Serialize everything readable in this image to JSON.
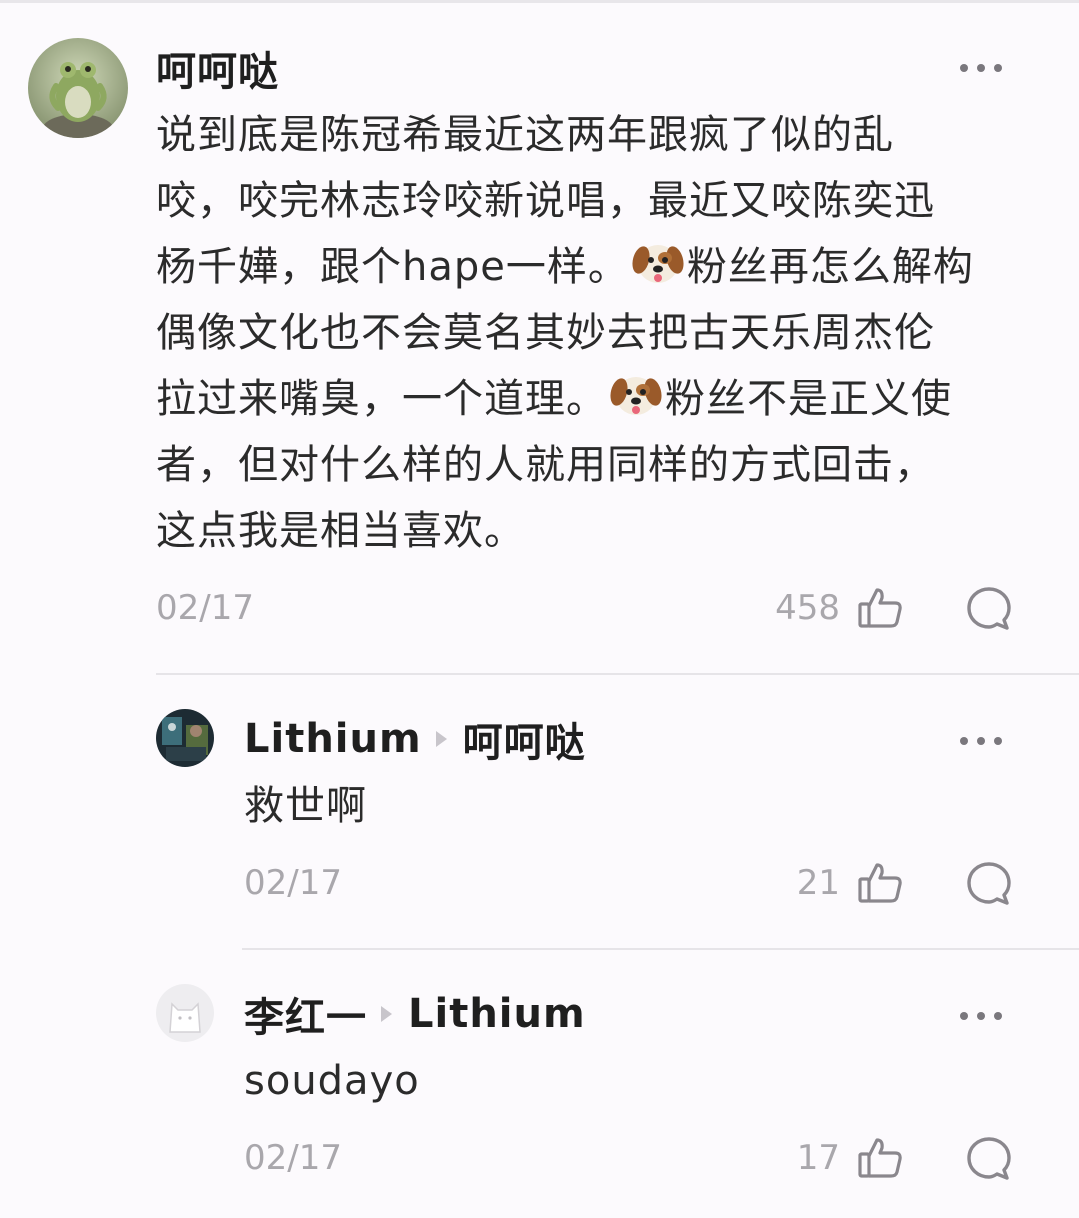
{
  "comments": [
    {
      "author": "呵呵哒",
      "avatar_icon": "frog-avatar-icon",
      "lines": [
        "说到底是陈冠希最近这两年跟疯了似的乱",
        "咬，咬完林志玲咬新说唱，最近又咬陈奕迅",
        "杨千嬅，跟个hape一样。",
        "粉丝再怎么解构",
        "偶像文化也不会莫名其妙去把古天乐周杰伦",
        "拉过来嘴臭，一个道理。",
        "粉丝不是正义使",
        "者，但对什么样的人就用同样的方式回击，",
        "这点我是相当喜欢。"
      ],
      "date": "02/17",
      "likes": "458"
    },
    {
      "author": "Lithium",
      "reply_to": "呵呵哒",
      "avatar_icon": "photo-avatar-icon",
      "text": "救世啊",
      "date": "02/17",
      "likes": "21"
    },
    {
      "author": "李红一",
      "reply_to": "Lithium",
      "avatar_icon": "default-avatar-icon",
      "text": "soudayo",
      "date": "02/17",
      "likes": "17"
    }
  ],
  "icons": {
    "like": "thumbs-up-icon",
    "reply": "speech-bubble-icon",
    "more": "more-dots-icon",
    "emoji": "dog-face-emoji"
  }
}
